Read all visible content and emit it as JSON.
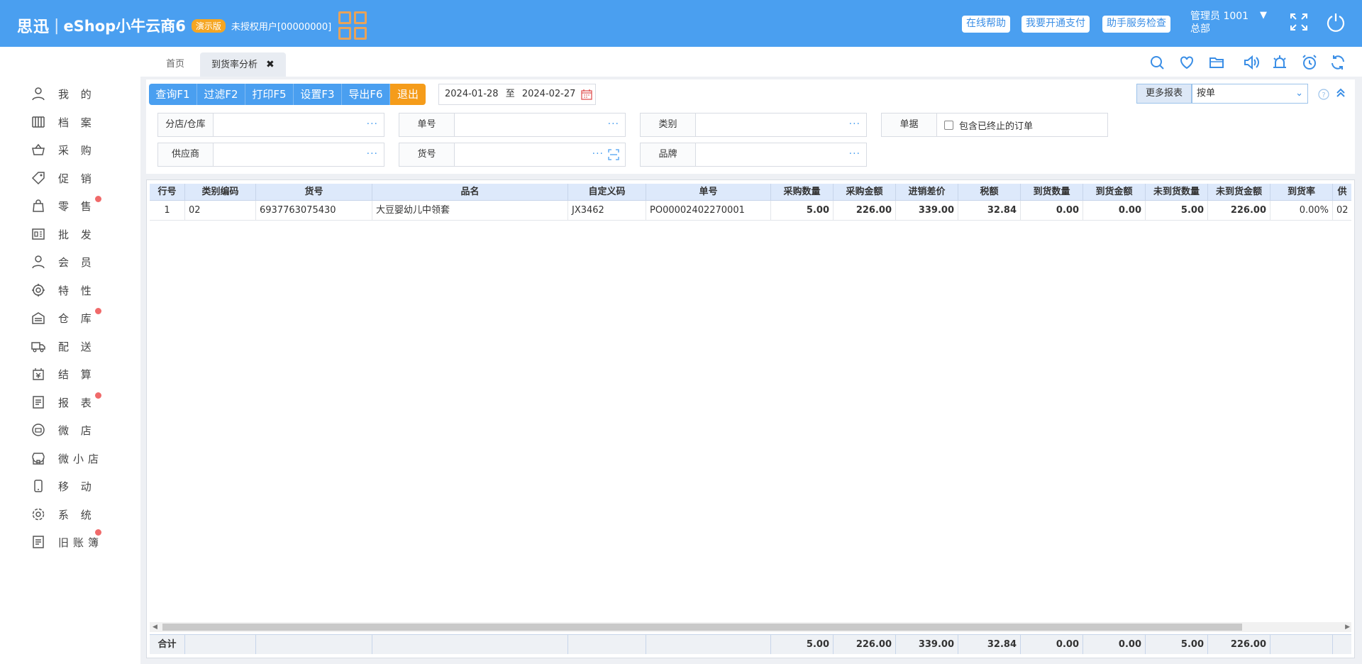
{
  "app": {
    "logo_cn": "思迅",
    "logo_name": "eShop小牛云商6",
    "edition_badge": "演示版",
    "license_text": "未授权用户[00000000]"
  },
  "header_buttons": [
    "在线帮助",
    "我要开通支付",
    "助手服务检查"
  ],
  "user": {
    "name": "管理员 1001",
    "branch": "总部"
  },
  "sidebar": {
    "items": [
      {
        "label": "我 的",
        "icon": "user-icon",
        "dot": false
      },
      {
        "label": "档 案",
        "icon": "archive-icon",
        "dot": false
      },
      {
        "label": "采 购",
        "icon": "basket-icon",
        "dot": false
      },
      {
        "label": "促 销",
        "icon": "tag-icon",
        "dot": false
      },
      {
        "label": "零 售",
        "icon": "bag-icon",
        "dot": true
      },
      {
        "label": "批 发",
        "icon": "wholesale-icon",
        "dot": false
      },
      {
        "label": "会 员",
        "icon": "member-icon",
        "dot": false
      },
      {
        "label": "特 性",
        "icon": "feature-icon",
        "dot": false
      },
      {
        "label": "仓 库",
        "icon": "warehouse-icon",
        "dot": true
      },
      {
        "label": "配 送",
        "icon": "truck-icon",
        "dot": false
      },
      {
        "label": "结 算",
        "icon": "settlement-icon",
        "dot": false
      },
      {
        "label": "报 表",
        "icon": "report-icon",
        "dot": true
      },
      {
        "label": "微 店",
        "icon": "microstore-icon",
        "dot": false
      },
      {
        "label": "微小店",
        "icon": "shop-icon",
        "dot": false
      },
      {
        "label": "移 动",
        "icon": "mobile-icon",
        "dot": false
      },
      {
        "label": "系 统",
        "icon": "gear-icon",
        "dot": false
      },
      {
        "label": "旧账簿",
        "icon": "ledger-icon",
        "dot": true
      }
    ]
  },
  "tabs": [
    {
      "label": "首页"
    },
    {
      "label": "到货率分析",
      "active": true
    }
  ],
  "toolbar": {
    "buttons": [
      "查询F1",
      "过滤F2",
      "打印F5",
      "设置F3",
      "导出F6",
      "退出"
    ],
    "date_from": "2024-01-28",
    "date_sep": "至",
    "date_to": "2024-02-27",
    "more_reports_label": "更多报表",
    "more_reports_value": "按单"
  },
  "filters": {
    "branch": "分店/仓库",
    "order_no": "单号",
    "category": "类别",
    "document": "单据",
    "include_terminated": "包含已终止的订单",
    "supplier": "供应商",
    "item_no": "货号",
    "brand": "品牌"
  },
  "table": {
    "columns": [
      "行号",
      "类别编码",
      "货号",
      "品名",
      "自定义码",
      "单号",
      "采购数量",
      "采购金额",
      "进销差价",
      "税额",
      "到货数量",
      "到货金额",
      "未到货数量",
      "未到货金额",
      "到货率",
      "供"
    ],
    "rows": [
      [
        "1",
        "02",
        "6937763075430",
        "大豆婴幼儿中领套",
        "JX3462",
        "PO00002402270001",
        "5.00",
        "226.00",
        "339.00",
        "32.84",
        "0.00",
        "0.00",
        "5.00",
        "226.00",
        "0.00%",
        "02"
      ]
    ],
    "totals": {
      "label": "合计",
      "values": [
        "5.00",
        "226.00",
        "339.00",
        "32.84",
        "0.00",
        "0.00",
        "5.00",
        "226.00"
      ]
    }
  },
  "colors": {
    "primary": "#4a9ff0",
    "exit": "#f59c1a",
    "badge": "#f5a623",
    "dot": "#f06a6a"
  }
}
